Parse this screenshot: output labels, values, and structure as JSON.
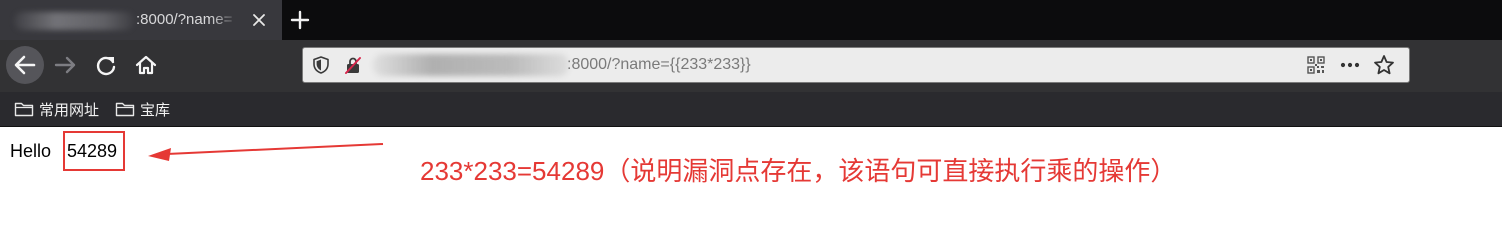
{
  "browser": {
    "tab": {
      "title": ":8000/?name=",
      "title_blurred": true
    },
    "new_tab_icon": "plus-icon",
    "nav": {
      "back_icon": "back-arrow-icon",
      "forward_icon": "forward-arrow-icon",
      "reload_icon": "reload-icon",
      "home_icon": "home-icon"
    },
    "urlbar": {
      "host_blurred": true,
      "url_visible": ":8000/?name={{233*233}}",
      "icons": [
        "shield-icon",
        "insecure-lock-icon",
        "qr-code-icon",
        "more-icon",
        "bookmark-star-icon"
      ]
    },
    "bookmarks": [
      {
        "label": "常用网址",
        "icon": "folder-icon"
      },
      {
        "label": "宝库",
        "icon": "folder-icon"
      }
    ]
  },
  "page": {
    "greeting": "Hello",
    "result": "54289"
  },
  "annotation": {
    "text": "233*233=54289（说明漏洞点存在，该语句可直接执行乘的操作）",
    "color": "#e53935"
  }
}
